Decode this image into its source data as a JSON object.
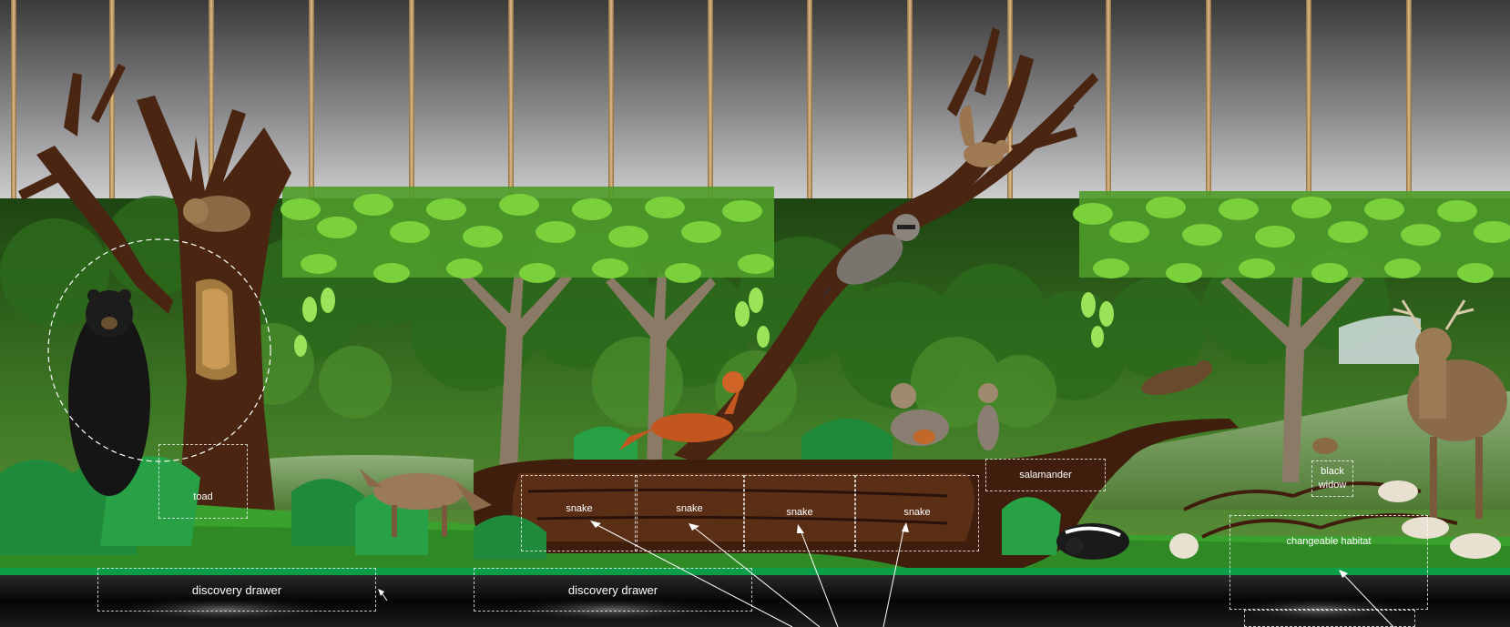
{
  "colors": {
    "wall_top": "#3c3c3c",
    "wall_bottom": "#c9c9cb",
    "bamboo": "#c8a070",
    "foliage": "#6ec236",
    "forest": "#2f5e1c",
    "trunk": "#4a2612",
    "grass": "#3a9a2c",
    "base_stripe": "#0e9d47",
    "water": "#6a8a52"
  },
  "exhibit": {
    "labels": {
      "toad": "toad",
      "snake_1": "snake",
      "snake_2": "snake",
      "snake_3": "snake",
      "snake_4": "snake",
      "salamander": "salamander",
      "black_widow": "black widow",
      "changeable_habitat": "changeable habitat",
      "discovery_drawer_1": "discovery drawer",
      "discovery_drawer_2": "discovery drawer"
    },
    "animals": [
      "black bear",
      "bobcat",
      "coyote",
      "red fox",
      "gray fox",
      "gray fox kit",
      "raccoon",
      "squirrel",
      "mink",
      "skunk",
      "white-tailed deer",
      "chipmunk"
    ]
  }
}
